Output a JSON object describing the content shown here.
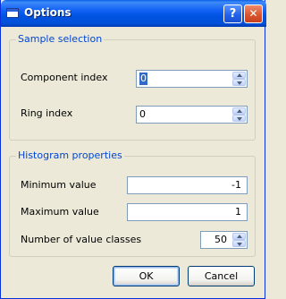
{
  "window": {
    "title": "Options",
    "help_label": "?",
    "close_label": "✕"
  },
  "sample_selection": {
    "legend": "Sample selection",
    "component_index": {
      "label": "Component index",
      "value": "0"
    },
    "ring_index": {
      "label": "Ring index",
      "value": "0"
    }
  },
  "histogram_properties": {
    "legend": "Histogram properties",
    "minimum_value": {
      "label": "Minimum value",
      "value": "-1"
    },
    "maximum_value": {
      "label": "Maximum value",
      "value": "1"
    },
    "value_classes": {
      "label": "Number of value classes",
      "value": "50"
    }
  },
  "buttons": {
    "ok": "OK",
    "cancel": "Cancel"
  },
  "icons": {
    "app": "window-icon",
    "help": "help-icon",
    "close": "close-icon"
  }
}
